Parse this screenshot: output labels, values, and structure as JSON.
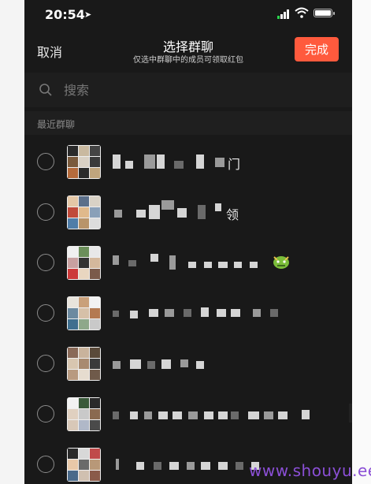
{
  "status_bar": {
    "time": "20:54"
  },
  "nav": {
    "cancel_label": "取消",
    "title": "选择群聊",
    "subtitle": "仅选中群聊中的成员可领取红包",
    "done_label": "完成"
  },
  "search": {
    "placeholder": "搜索"
  },
  "section": {
    "label": "最近群聊"
  },
  "groups": [
    {
      "visible_name_text": "门"
    },
    {
      "visible_name_text": "领"
    },
    {
      "visible_name_text": ""
    },
    {
      "visible_name_text": ""
    },
    {
      "visible_name_text": ""
    },
    {
      "visible_name_text": ""
    },
    {
      "visible_name_text": ""
    }
  ],
  "colors": {
    "accent": "#ff5a3d",
    "background": "#191919"
  },
  "watermark": "www.shouyu.ee"
}
